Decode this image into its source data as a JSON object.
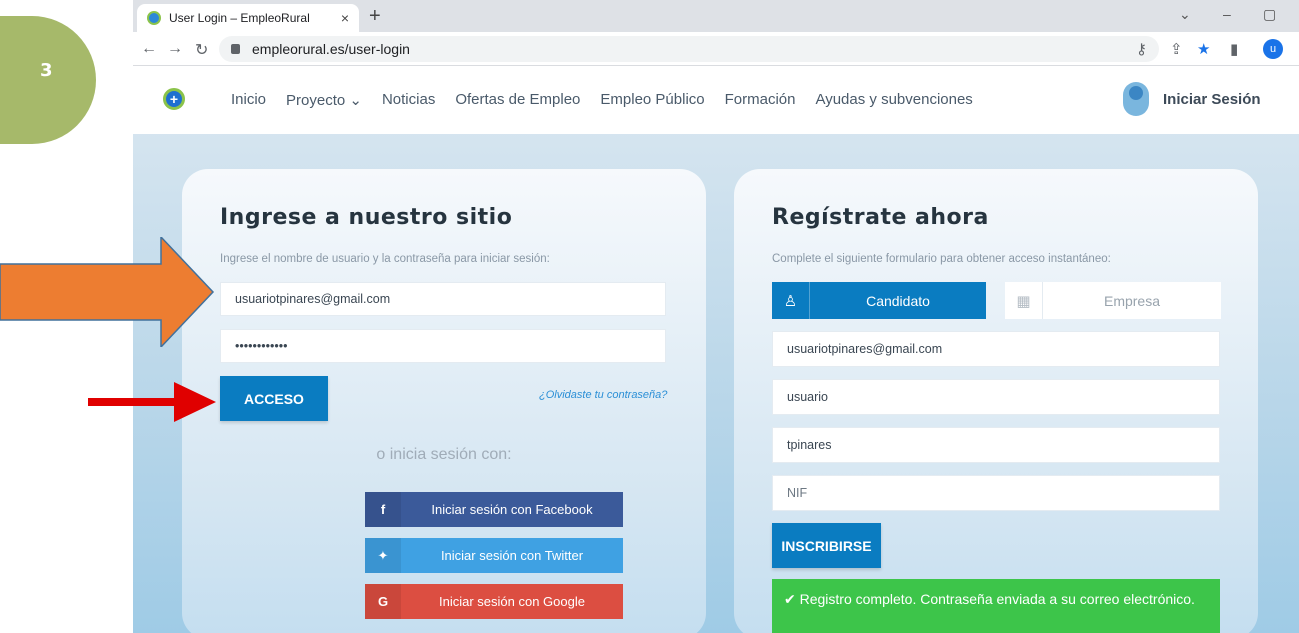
{
  "step": {
    "number": "3"
  },
  "browser": {
    "tab_title": "User Login – EmpleoRural",
    "tab_close": "×",
    "new_tab": "+",
    "url": "empleorural.es/user-login",
    "profile_initial": "u"
  },
  "site": {
    "nav": [
      "Inicio",
      "Proyecto ⌄",
      "Noticias",
      "Ofertas de Empleo",
      "Empleo Público",
      "Formación",
      "Ayudas y subvenciones"
    ],
    "login_link": "Iniciar Sesión"
  },
  "login": {
    "title": "Ingrese a nuestro sitio",
    "subtitle": "Ingrese el nombre de usuario y la contraseña para iniciar sesión:",
    "username_value": "usuariotpinares@gmail.com",
    "password_value": "••••••••••••",
    "submit_label": "ACCESO",
    "forgot_label": "¿Olvidaste tu contraseña?",
    "or_with": "o inicia sesión con:",
    "facebook_label": "Iniciar sesión con Facebook",
    "twitter_label": "Iniciar sesión con Twitter",
    "google_label": "Iniciar sesión con Google",
    "facebook_icon": "f",
    "twitter_icon": "🐦",
    "google_icon": "G"
  },
  "register": {
    "title": "Regístrate ahora",
    "subtitle": "Complete el siguiente formulario para obtener acceso instantáneo:",
    "candidate_label": "Candidato",
    "company_label": "Empresa",
    "email_value": "usuariotpinares@gmail.com",
    "first_name_value": "usuario",
    "last_name_value": "tpinares",
    "nif_placeholder": "NIF",
    "submit_label": "INSCRIBIRSE",
    "success_message": "✔ Registro completo. Contraseña enviada a su correo electrónico."
  },
  "colors": {
    "accent": "#0a7cc1",
    "success": "#3dc54a",
    "arrow_orange": "#ed7d31",
    "arrow_red": "#e00000",
    "badge": "#a6b96a"
  }
}
